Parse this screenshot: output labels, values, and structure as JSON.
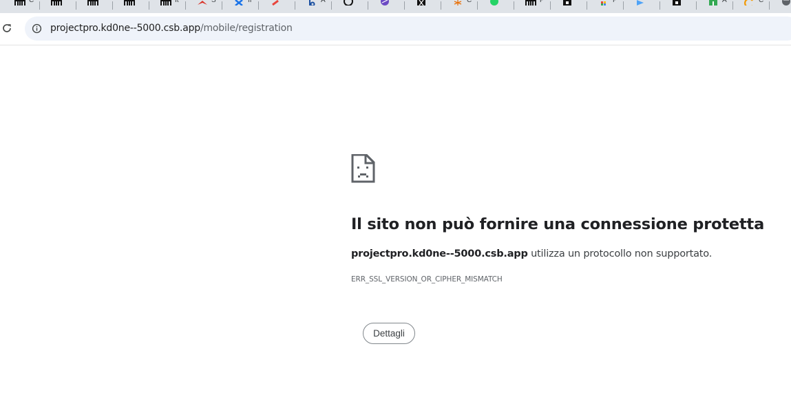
{
  "tabs": [
    {
      "favicon": "piano-icon",
      "title": "C"
    },
    {
      "favicon": "piano-icon",
      "title": ""
    },
    {
      "favicon": "piano-icon",
      "title": ""
    },
    {
      "favicon": "piano-icon",
      "title": ""
    },
    {
      "favicon": "piano-icon",
      "title": "It"
    },
    {
      "favicon": "red-bird-icon",
      "title": "S"
    },
    {
      "favicon": "blue-x-icon",
      "title": "II"
    },
    {
      "favicon": "red-pencil-icon",
      "title": ""
    },
    {
      "favicon": "b-logo-icon",
      "title": "A"
    },
    {
      "favicon": "openai-icon",
      "title": ""
    },
    {
      "favicon": "purple-swirl-icon",
      "title": ""
    },
    {
      "favicon": "x-logo-icon",
      "title": ""
    },
    {
      "favicon": "orange-burst-icon",
      "title": "C"
    },
    {
      "favicon": "whatsapp-icon",
      "title": ""
    },
    {
      "favicon": "piano-icon",
      "title": "P"
    },
    {
      "favicon": "dark-square-icon",
      "title": ""
    },
    {
      "favicon": "colorful-grid-icon",
      "title": "P"
    },
    {
      "favicon": "blue-arrow-icon",
      "title": ""
    },
    {
      "favicon": "dark-square-icon",
      "title": ""
    },
    {
      "favicon": "green-square-icon",
      "title": "A"
    },
    {
      "favicon": "orange-c-icon",
      "title": "C"
    },
    {
      "favicon": "globe-icon",
      "title": ""
    }
  ],
  "address_bar": {
    "host": "projectpro.kd0ne--5000.csb.app",
    "path": "/mobile/registration"
  },
  "error": {
    "icon": "sad-document-icon",
    "title": "Il sito non può fornire una connessione protetta",
    "host": "projectpro.kd0ne--5000.csb.app",
    "description_suffix": " utilizza un protocollo non supportato.",
    "code": "ERR_SSL_VERSION_OR_CIPHER_MISMATCH",
    "details_button": "Dettagli"
  },
  "colors": {
    "tabstrip_bg": "#dfe3e8",
    "omnibox_bg": "#eff3fa",
    "title_text": "#202124",
    "secondary_text": "#5f6368"
  }
}
